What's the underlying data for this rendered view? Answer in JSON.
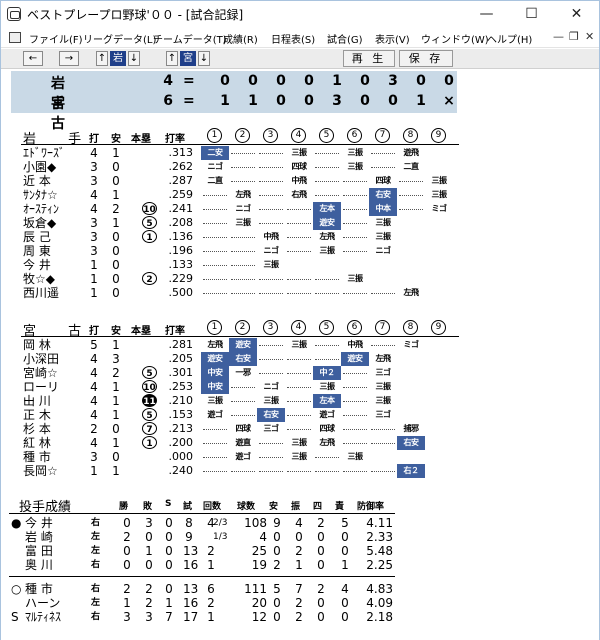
{
  "window": {
    "title": "ベストプレープロ野球'００ - [試合記録]",
    "min": "—",
    "max": "☐",
    "close": "✕"
  },
  "menu": [
    "ファイル(F)",
    "リーグデータ(L)",
    "チームデータ(T)",
    "成績(R)",
    "日程表(S)",
    "試合(G)",
    "表示(V)",
    "ウィンドウ(W)",
    "ヘルプ(H)"
  ],
  "mdi": {
    "min": "—",
    "restore": "❐",
    "close": "✕"
  },
  "toolbar": {
    "left": "←",
    "right": "→",
    "up1": "↑",
    "team1": "岩",
    "down1": "↓",
    "up2": "↑",
    "team2": "宮",
    "down2": "↓",
    "replay": "再 生",
    "save": "保 存"
  },
  "score": {
    "teams": [
      {
        "name": "岩 手",
        "total": "4",
        "eq": "=",
        "innings": [
          "0",
          "0",
          "0",
          "0",
          "1",
          "0",
          "3",
          "0",
          "0"
        ]
      },
      {
        "name": "宮 古",
        "total": "6",
        "eq": "=",
        "innings": [
          "1",
          "1",
          "0",
          "0",
          "3",
          "0",
          "0",
          "1",
          "×"
        ]
      }
    ]
  },
  "headers": {
    "team1": "岩 手",
    "team2": "宮 古",
    "bat": "打",
    "hit": "安",
    "hr": "本塁",
    "avg": "打率",
    "innings": [
      "1",
      "2",
      "3",
      "4",
      "5",
      "6",
      "7",
      "8",
      "9"
    ]
  },
  "batters1": [
    {
      "name": "ｴﾄﾞﾜｰｽﾞ",
      "ab": "4",
      "h": "1",
      "hr": "",
      "avg": ".313",
      "inn": [
        [
          "二安",
          1
        ],
        "",
        "",
        "三振",
        "",
        "三振",
        "",
        "遊飛",
        ""
      ]
    },
    {
      "name": "小園◆",
      "ab": "3",
      "h": "0",
      "hr": "",
      "avg": ".262",
      "inn": [
        "ニゴ",
        "",
        "",
        "四球",
        "",
        "三振",
        "",
        "二直",
        ""
      ]
    },
    {
      "name": "近 本",
      "ab": "3",
      "h": "0",
      "hr": "",
      "avg": ".287",
      "inn": [
        "二直",
        "",
        "",
        "中飛",
        "",
        "",
        "四球",
        "",
        "三振"
      ]
    },
    {
      "name": "ｻﾝﾀﾅ☆",
      "ab": "4",
      "h": "1",
      "hr": "",
      "avg": ".259",
      "inn": [
        "",
        "左飛",
        "",
        "右飛",
        "",
        "",
        [
          "右安",
          1
        ],
        "",
        "三振"
      ]
    },
    {
      "name": "ｵｰｽﾃｨﾝ",
      "ab": "4",
      "h": "2",
      "hr": "10",
      "avg": ".241",
      "inn": [
        "",
        "ニゴ",
        "",
        "",
        [
          "左本",
          1
        ],
        "",
        [
          "中本",
          1
        ],
        "",
        "ミゴ"
      ]
    },
    {
      "name": "坂倉◆",
      "ab": "3",
      "h": "1",
      "hr": "5",
      "avg": ".208",
      "inn": [
        "",
        "三振",
        "",
        "",
        [
          "遊安",
          1
        ],
        "",
        "三振",
        "",
        ""
      ]
    },
    {
      "name": "辰 己",
      "ab": "3",
      "h": "0",
      "hr": "1",
      "avg": ".136",
      "inn": [
        "",
        "",
        "中飛",
        "",
        "左飛",
        "",
        "三振",
        "",
        ""
      ]
    },
    {
      "name": "周 東",
      "ab": "3",
      "h": "0",
      "hr": "",
      "avg": ".196",
      "inn": [
        "",
        "",
        "ニゴ",
        "",
        "三振",
        "",
        "ニゴ",
        "",
        ""
      ]
    },
    {
      "name": "今 井",
      "ab": "1",
      "h": "0",
      "hr": "",
      "avg": ".133",
      "inn": [
        "",
        "",
        "三振",
        "",
        "",
        "",
        "",
        "",
        ""
      ]
    },
    {
      "name": "牧☆◆",
      "ab": "1",
      "h": "0",
      "hr": "2",
      "avg": ".229",
      "inn": [
        "",
        "",
        "",
        "",
        "",
        "三振",
        "",
        "",
        ""
      ]
    },
    {
      "name": "西川遥",
      "ab": "1",
      "h": "0",
      "hr": "",
      "avg": ".500",
      "inn": [
        "",
        "",
        "",
        "",
        "",
        "",
        "",
        "左飛",
        ""
      ]
    }
  ],
  "batters2": [
    {
      "name": "岡 林",
      "ab": "5",
      "h": "1",
      "hr": "",
      "avg": ".281",
      "inn": [
        "左飛",
        [
          "遊安",
          1
        ],
        "",
        "三振",
        "",
        "中飛",
        "",
        "ミゴ",
        ""
      ]
    },
    {
      "name": "小深田",
      "ab": "4",
      "h": "3",
      "hr": "",
      "avg": ".205",
      "inn": [
        [
          "遊安",
          1
        ],
        [
          "右安",
          1
        ],
        "",
        "",
        "",
        [
          "遊安",
          1
        ],
        "左飛",
        "",
        ""
      ]
    },
    {
      "name": "宮崎☆",
      "ab": "4",
      "h": "2",
      "hr": "5",
      "avg": ".301",
      "inn": [
        [
          "中安",
          1
        ],
        "一邪",
        "",
        "",
        [
          "中２",
          1
        ],
        "",
        "三ゴ",
        "",
        ""
      ]
    },
    {
      "name": "ローリー",
      "ab": "4",
      "h": "1",
      "hr": "10",
      "avg": ".253",
      "inn": [
        [
          "中安",
          1
        ],
        "",
        "ニゴ",
        "",
        "三振",
        "",
        "三振",
        "",
        ""
      ]
    },
    {
      "name": "山 川",
      "ab": "4",
      "h": "1",
      "hr": "11b",
      "avg": ".210",
      "inn": [
        "三振",
        "",
        "三振",
        "",
        [
          "左本",
          1
        ],
        "",
        "三振",
        "",
        ""
      ]
    },
    {
      "name": "正 木",
      "ab": "4",
      "h": "1",
      "hr": "5",
      "avg": ".153",
      "inn": [
        "遊ゴ",
        "",
        [
          "右安",
          1
        ],
        "",
        "遊ゴ",
        "",
        "三ゴ",
        "",
        ""
      ]
    },
    {
      "name": "杉 本",
      "ab": "2",
      "h": "0",
      "hr": "7",
      "avg": ".213",
      "inn": [
        "",
        "四球",
        "三ゴ",
        "",
        "四球",
        "",
        "",
        "捕邪",
        ""
      ]
    },
    {
      "name": "紅 林",
      "ab": "4",
      "h": "1",
      "hr": "1",
      "avg": ".200",
      "inn": [
        "",
        "遊直",
        "",
        "三振",
        "左飛",
        "",
        "",
        "右安h",
        ""
      ]
    },
    {
      "name": "種 市",
      "ab": "3",
      "h": "0",
      "hr": "",
      "avg": ".000",
      "inn": [
        "",
        "遊ゴ",
        "",
        "三振",
        "",
        "三振",
        "",
        "",
        ""
      ]
    },
    {
      "name": "長岡☆",
      "ab": "1",
      "h": "1",
      "hr": "",
      "avg": ".240",
      "inn": [
        "",
        "",
        "",
        "",
        "",
        "",
        "",
        [
          "右２",
          1
        ],
        ""
      ]
    }
  ],
  "pitching": {
    "title": "投手成績",
    "cols": [
      "勝",
      "敗",
      "S",
      "試",
      "回数",
      "球数",
      "安",
      "振",
      "四",
      "責",
      "防御率"
    ],
    "team1": [
      {
        "mark": "●",
        "name": "今 井",
        "hand": "右",
        "w": "0",
        "l": "3",
        "s": "0",
        "g": "8",
        "ip": "4",
        "frac": "2/3",
        "np": "108",
        "h": "9",
        "k": "4",
        "bb": "2",
        "er": "5",
        "era": "4.11"
      },
      {
        "mark": "",
        "name": "岩 崎",
        "hand": "左",
        "w": "2",
        "l": "0",
        "s": "0",
        "g": "9",
        "ip": "",
        "frac": "1/3",
        "np": "4",
        "h": "0",
        "k": "0",
        "bb": "0",
        "er": "0",
        "era": "2.33"
      },
      {
        "mark": "",
        "name": "富 田",
        "hand": "左",
        "w": "0",
        "l": "1",
        "s": "0",
        "g": "13",
        "ip": "2",
        "frac": "",
        "np": "25",
        "h": "0",
        "k": "2",
        "bb": "0",
        "er": "0",
        "era": "5.48"
      },
      {
        "mark": "",
        "name": "奥 川",
        "hand": "右",
        "w": "0",
        "l": "0",
        "s": "0",
        "g": "16",
        "ip": "1",
        "frac": "",
        "np": "19",
        "h": "2",
        "k": "1",
        "bb": "0",
        "er": "1",
        "era": "2.25"
      }
    ],
    "team2": [
      {
        "mark": "○",
        "name": "種 市",
        "hand": "右",
        "w": "2",
        "l": "2",
        "s": "0",
        "g": "13",
        "ip": "6",
        "frac": "",
        "np": "111",
        "h": "5",
        "k": "7",
        "bb": "2",
        "er": "4",
        "era": "4.83"
      },
      {
        "mark": "",
        "name": "ハーン",
        "hand": "左",
        "w": "1",
        "l": "2",
        "s": "1",
        "g": "16",
        "ip": "2",
        "frac": "",
        "np": "20",
        "h": "0",
        "k": "2",
        "bb": "0",
        "er": "0",
        "era": "4.09"
      },
      {
        "mark": "S",
        "name": "ﾏﾙﾃｨﾈｽ",
        "hand": "右",
        "w": "3",
        "l": "3",
        "s": "7",
        "g": "17",
        "ip": "1",
        "frac": "",
        "np": "12",
        "h": "0",
        "k": "2",
        "bb": "0",
        "er": "0",
        "era": "2.18"
      }
    ]
  }
}
